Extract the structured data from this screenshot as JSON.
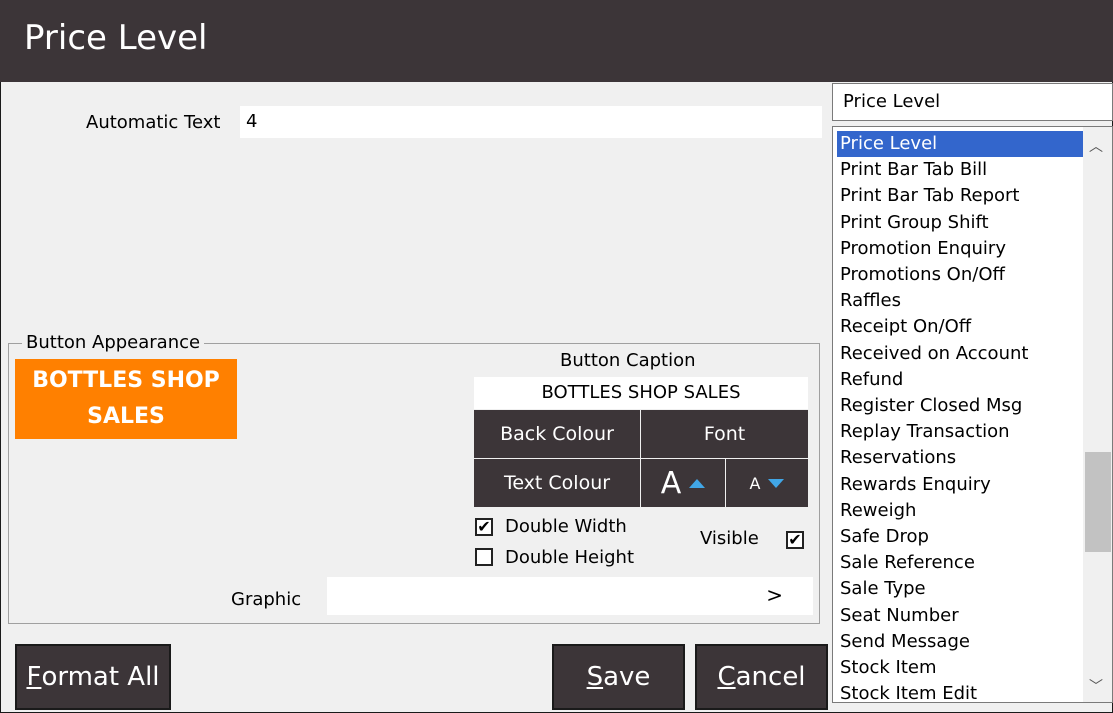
{
  "window": {
    "title": "Price Level"
  },
  "automatic_text": {
    "label": "Automatic Text",
    "value": "4"
  },
  "button_appearance": {
    "legend": "Button Appearance",
    "preview_line1": "BOTTLES SHOP",
    "preview_line2": "SALES",
    "preview_color": "#ff8000",
    "caption_label": "Button Caption",
    "caption_value": "BOTTLES SHOP SALES",
    "back_colour_label": "Back Colour",
    "font_label": "Font",
    "text_colour_label": "Text Colour",
    "font_increase_glyph": "A",
    "font_decrease_glyph": "A",
    "double_width_label": "Double Width",
    "double_width_checked": true,
    "double_height_label": "Double Height",
    "double_height_checked": false,
    "visible_label": "Visible",
    "visible_checked": true,
    "graphic_label": "Graphic",
    "graphic_value": "",
    "graphic_arrow": ">"
  },
  "buttons": {
    "format_all": {
      "mnemonic": "F",
      "rest": "ormat All"
    },
    "save": {
      "mnemonic": "S",
      "rest": "ave"
    },
    "cancel": {
      "mnemonic": "C",
      "rest": "ancel"
    }
  },
  "function_selector": {
    "selected": "Price Level",
    "items": [
      "Price Level",
      "Print Bar Tab Bill",
      "Print Bar Tab Report",
      "Print Group Shift",
      "Promotion Enquiry",
      "Promotions On/Off",
      "Raffles",
      "Receipt On/Off",
      "Received on Account",
      "Refund",
      "Register Closed Msg",
      "Replay Transaction",
      "Reservations",
      "Rewards Enquiry",
      "Reweigh",
      "Safe Drop",
      "Sale Reference",
      "Sale Type",
      "Seat Number",
      "Send Message",
      "Stock Item",
      "Stock Item Edit"
    ]
  },
  "colors": {
    "dark": "#3c3538",
    "selection": "#3366cc",
    "accent_arrow": "#41a6e6"
  }
}
